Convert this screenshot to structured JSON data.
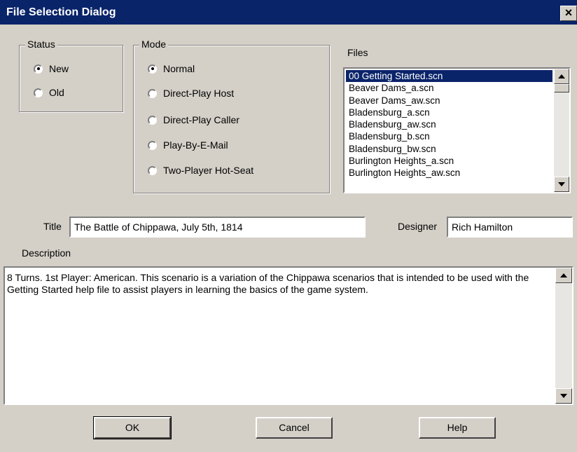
{
  "window": {
    "title": "File Selection Dialog",
    "close_glyph": "×"
  },
  "status_group": {
    "legend": "Status",
    "options": [
      {
        "label": "New",
        "selected": true
      },
      {
        "label": "Old",
        "selected": false
      }
    ]
  },
  "mode_group": {
    "legend": "Mode",
    "options": [
      {
        "label": "Normal",
        "selected": true
      },
      {
        "label": "Direct-Play Host",
        "selected": false
      },
      {
        "label": "Direct-Play Caller",
        "selected": false
      },
      {
        "label": "Play-By-E-Mail",
        "selected": false
      },
      {
        "label": "Two-Player Hot-Seat",
        "selected": false
      }
    ]
  },
  "files": {
    "label": "Files",
    "selected_index": 0,
    "items": [
      "00 Getting Started.scn",
      "Beaver Dams_a.scn",
      "Beaver Dams_aw.scn",
      "Bladensburg_a.scn",
      "Bladensburg_aw.scn",
      "Bladensburg_b.scn",
      "Bladensburg_bw.scn",
      "Burlington Heights_a.scn",
      "Burlington Heights_aw.scn"
    ]
  },
  "title_field": {
    "label": "Title",
    "value": "The Battle of Chippawa, July 5th, 1814"
  },
  "designer_field": {
    "label": "Designer",
    "value": "Rich Hamilton"
  },
  "description": {
    "label": "Description",
    "value": "8 Turns. 1st Player: American. This scenario is a variation of the Chippawa scenarios that is intended to be used with the Getting Started help file to assist players in learning the basics of the game system."
  },
  "buttons": {
    "ok": "OK",
    "cancel": "Cancel",
    "help": "Help"
  },
  "colors": {
    "titlebar": "#0a246a",
    "face": "#d4d0c8",
    "selection": "#0a246a"
  }
}
